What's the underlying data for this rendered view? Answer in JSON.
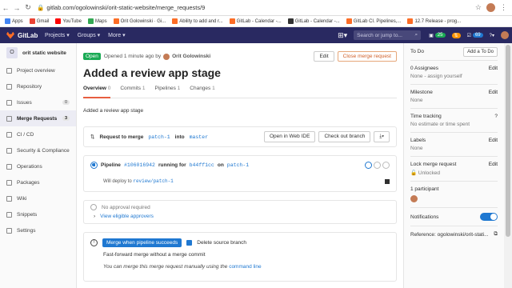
{
  "browser": {
    "url": "gitlab.com/ogolowinski/orit-static-website/merge_requests/9"
  },
  "bookmarks": [
    {
      "label": "Apps",
      "color": "#4285f4"
    },
    {
      "label": "Gmail",
      "color": "#ea4335"
    },
    {
      "label": "YouTube",
      "color": "#ff0000"
    },
    {
      "label": "Maps",
      "color": "#34a853"
    },
    {
      "label": "Orit Golowinski · Gi...",
      "color": "#fc6d26"
    },
    {
      "label": "Ability to add and r...",
      "color": "#fc6d26"
    },
    {
      "label": "GitLab - Calendar -...",
      "color": "#fc6d26"
    },
    {
      "label": "GitLab - Calendar -...",
      "color": "#333333"
    },
    {
      "label": "GitLab CI. Pipelines,...",
      "color": "#fc6d26"
    },
    {
      "label": "12.7 Release - prog...",
      "color": "#fc6d26"
    }
  ],
  "topnav": {
    "brand": "GitLab",
    "menu": [
      "Projects ▾",
      "Groups ▾",
      "More ▾"
    ],
    "search_placeholder": "Search or jump to...",
    "counters": [
      "25",
      "69"
    ]
  },
  "sidebar": {
    "project_letter": "O",
    "project_name": "orit static website",
    "items": [
      {
        "label": "Project overview"
      },
      {
        "label": "Repository"
      },
      {
        "label": "Issues",
        "count": "0"
      },
      {
        "label": "Merge Requests",
        "count": "3"
      },
      {
        "label": "CI / CD"
      },
      {
        "label": "Security & Compliance"
      },
      {
        "label": "Operations"
      },
      {
        "label": "Packages"
      },
      {
        "label": "Wiki"
      },
      {
        "label": "Snippets"
      },
      {
        "label": "Settings"
      }
    ]
  },
  "mr": {
    "status": "Open",
    "opened": "Opened 1 minute ago by",
    "author": "Orit Golowinski",
    "edit_label": "Edit",
    "close_label": "Close merge request",
    "title": "Added a review app stage",
    "tabs": [
      {
        "label": "Overview",
        "count": "0"
      },
      {
        "label": "Commits",
        "count": "1"
      },
      {
        "label": "Pipelines",
        "count": "1"
      },
      {
        "label": "Changes",
        "count": "1"
      }
    ],
    "description": "Added a review app stage",
    "request_prefix": "Request to merge",
    "source_branch": "patch-1",
    "into": "into",
    "target_branch": "master",
    "open_ide": "Open in Web IDE",
    "checkout": "Check out branch",
    "pipeline_label": "Pipeline",
    "pipeline_id": "#106016942",
    "pipeline_running": "running for",
    "commit": "b44ff1cc",
    "on": "on",
    "pipeline_branch": "patch-1",
    "deploy_text": "Will deploy to",
    "deploy_target": "review/patch-1",
    "approval": "No approval required",
    "approvers_link": "View eligible approvers",
    "merge_button": "Merge when pipeline succeeds",
    "delete_branch": "Delete source branch",
    "ff_text": "Fast-forward merge without a merge commit",
    "manual_text": "You can merge this merge request manually using the",
    "cmdline": "command line"
  },
  "right": {
    "todo": "To Do",
    "add_todo": "Add a To Do",
    "assignees": "0 Assignees",
    "assignees_value": "None - assign yourself",
    "milestone": "Milestone",
    "milestone_value": "None",
    "time": "Time tracking",
    "time_value": "No estimate or time spent",
    "labels": "Labels",
    "labels_value": "None",
    "lock": "Lock merge request",
    "lock_value": "Unlocked",
    "participants": "1 participant",
    "notifications": "Notifications",
    "reference": "Reference: ogolowinski/orit-stati...",
    "edit": "Edit"
  }
}
